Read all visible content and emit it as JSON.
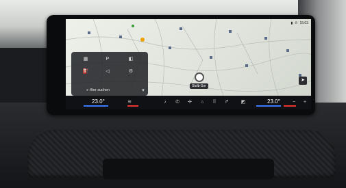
{
  "status": {
    "time": "15:03"
  },
  "panel": {
    "search_label": "Hier suchen"
  },
  "map": {
    "destination_label": "Stolb-Sor"
  },
  "dock": {
    "temp_left": "23.0°",
    "temp_right": "23.0°"
  },
  "colors": {
    "accent_blue": "#3a7bff",
    "accent_red": "#e33333"
  }
}
